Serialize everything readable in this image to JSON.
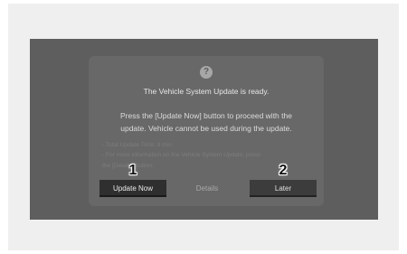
{
  "dialog": {
    "help_icon": "?",
    "title": "The Vehicle System Update is ready.",
    "body_line1": "Press the [Update Now] button to proceed with the",
    "body_line2": "update. Vehicle cannot be used during the update.",
    "note_line1": "- Total Update Time: 8 min",
    "note_line2": "- For more information on the Vehicle System Update, press",
    "note_line3": "the [Details] button."
  },
  "buttons": {
    "update_now": "Update Now",
    "details": "Details",
    "later": "Later"
  },
  "callouts": {
    "one": "1",
    "two": "2"
  },
  "icons": {
    "help": "question-circle-icon"
  },
  "colors": {
    "screen_background": "#5e5e5e",
    "dialog_background": "#686868",
    "primary_button": "#2f2f2f"
  }
}
